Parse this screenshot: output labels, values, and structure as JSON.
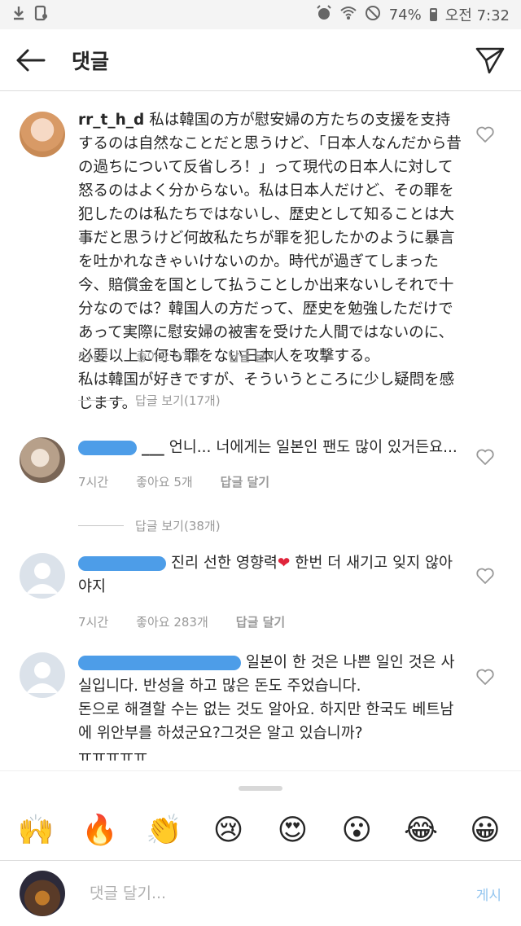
{
  "status_bar": {
    "battery": "74%",
    "time": "오전 7:32"
  },
  "header": {
    "title": "댓글"
  },
  "comments": [
    {
      "username": "rr_t_h_d",
      "text": "私は韓国の方が慰安婦の方たちの支援を支持するのは自然なことだと思うけど、「日本人なんだから昔の過ちについて反省しろ！」って現代の日本人に対して怒るのはよく分からない。私は日本人だけど、その罪を犯したのは私たちではないし、歴史として知ることは大事だと思うけど何故私たちが罪を犯したかのように暴言を吐かれなきゃいけないのか。時代が過ぎてしまった今、賠償金を国として払うことしか出来ないしそれで十分なのでは？韓国人の方だって、歴史を勉強しただけであって実際に慰安婦の被害を受けた人間ではないのに、必要以上に何も罪をない日本人を攻撃する。\n私は韓国が好きですが、そういうところに少し疑問を感じます。",
      "time": "5시간",
      "likes": "좋아요 97개",
      "reply": "답글 달기",
      "view_replies": "답글 보기(17개)"
    },
    {
      "username_suffix": "___",
      "text": "언니... 너에게는 일본인 팬도 많이 있거든요...",
      "time": "7시간",
      "likes": "좋아요 5개",
      "reply": "답글 달기",
      "view_replies": "답글 보기(38개)"
    },
    {
      "text_before": "진리 선한 영향력",
      "heart": "❤",
      "text_after": " 한번 더 새기고 잊지 않아야지",
      "time": "7시간",
      "likes": "좋아요 283개",
      "reply": "답글 달기"
    },
    {
      "text": "일본이 한 것은 나쁜 일인 것은 사실입니다. 반성을 하고 많은 돈도 주었습니다.\n돈으로 해결할 수는 없는 것도 알아요. 하지만 한국도 베트남에 위안부를 하셨군요?그것은 알고 있습니까?\nㅠㅠㅠㅠㅠ"
    }
  ],
  "emoji_bar": {
    "emojis": [
      "🙌",
      "🔥",
      "👏",
      "😢",
      "😍",
      "😮",
      "😂",
      "😀"
    ]
  },
  "input": {
    "placeholder": "댓글 달기...",
    "post_label": "게시"
  },
  "colors": {
    "text": "#262626",
    "meta": "#999999",
    "link_disabled": "#93c5ef",
    "blur": "#4d9de8"
  }
}
